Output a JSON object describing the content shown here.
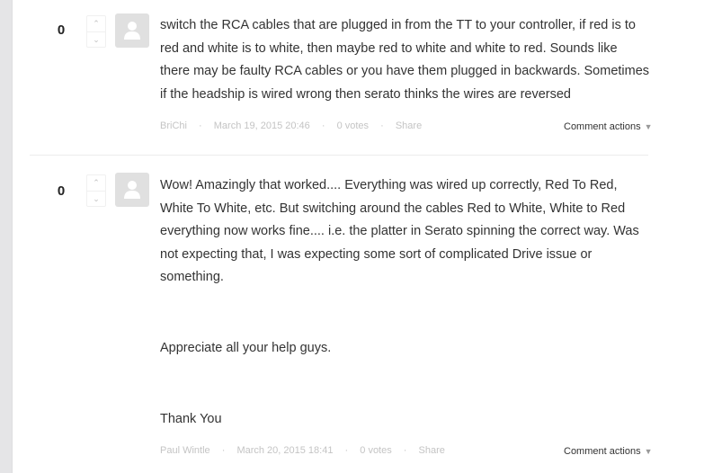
{
  "comments": [
    {
      "vote_count": "0",
      "vote_up_glyph": "⌃",
      "vote_down_glyph": "⌄",
      "paragraphs": [
        "switch the RCA cables that are plugged in from the TT to your controller, if red is to red and white is to white, then maybe red to white and white to red. Sounds like there may be faulty RCA cables or you have them plugged in backwards. Sometimes if the headship is wired wrong then serato thinks the wires are reversed"
      ],
      "author": "BriChi",
      "date": "March 19, 2015 20:46",
      "votes": "0 votes",
      "share": "Share",
      "actions_label": "Comment actions",
      "actions_caret": "▼"
    },
    {
      "vote_count": "0",
      "vote_up_glyph": "⌃",
      "vote_down_glyph": "⌄",
      "paragraphs": [
        "Wow! Amazingly that worked.... Everything was wired up correctly, Red To Red, White To White, etc. But switching around the cables Red to White, White to Red everything now works fine.... i.e. the platter in Serato spinning the correct way. Was not expecting that, I was expecting some sort of complicated Drive issue or something.",
        "Appreciate all your help guys.",
        "Thank You"
      ],
      "author": "Paul Wintle",
      "date": "March 20, 2015 18:41",
      "votes": "0 votes",
      "share": "Share",
      "actions_label": "Comment actions",
      "actions_caret": "▼"
    }
  ],
  "separator": "·",
  "colors": {
    "meta_text": "#c4c4c4",
    "avatar_bg": "#e0e0e0",
    "left_strip": "#e5e5e7"
  }
}
